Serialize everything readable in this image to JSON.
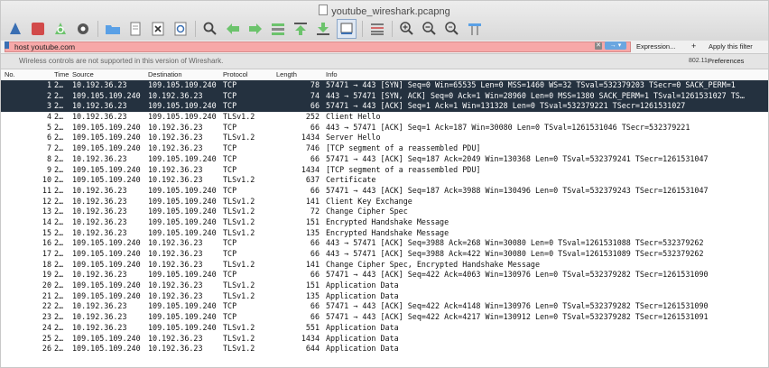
{
  "window": {
    "title": "youtube_wireshark.pcapng"
  },
  "toolbar": {
    "icons": [
      "shark-fin-start-icon",
      "stop-icon",
      "restart-icon",
      "gear-options-icon",
      "folder-open-icon",
      "file-icon",
      "close-file-icon",
      "reload-icon",
      "search-icon",
      "back-arrow-icon",
      "forward-arrow-icon",
      "go-to-packet-icon",
      "first-packet-icon",
      "last-packet-icon",
      "autoscroll-icon",
      "colorize-icon",
      "zoom-in-icon",
      "zoom-out-icon",
      "zoom-reset-icon",
      "resize-columns-icon"
    ]
  },
  "filter": {
    "value": "host youtube.com",
    "expression_label": "Expression...",
    "plus_label": "+",
    "apply_label": "Apply this filter"
  },
  "wireless": {
    "message": "Wireless controls are not supported in this version of Wireshark.",
    "version": "802.11",
    "preferences": "Preferences"
  },
  "columns": {
    "no": "No.",
    "time": "Time",
    "source": "Source",
    "destination": "Destination",
    "protocol": "Protocol",
    "length": "Length",
    "info": "Info"
  },
  "packets": [
    {
      "no": "1",
      "time": "2…",
      "src": "10.192.36.23",
      "dst": "109.105.109.240",
      "proto": "TCP",
      "len": "78",
      "info": "57471 → 443 [SYN] Seq=0 Win=65535 Len=0 MSS=1460 WS=32 TSval=532379203 TSecr=0 SACK_PERM=1",
      "sel": true
    },
    {
      "no": "2",
      "time": "2…",
      "src": "109.105.109.240",
      "dst": "10.192.36.23",
      "proto": "TCP",
      "len": "74",
      "info": "443 → 57471 [SYN, ACK] Seq=0 Ack=1 Win=28960 Len=0 MSS=1380 SACK_PERM=1 TSval=1261531027 TS…",
      "sel": true
    },
    {
      "no": "3",
      "time": "2…",
      "src": "10.192.36.23",
      "dst": "109.105.109.240",
      "proto": "TCP",
      "len": "66",
      "info": "57471 → 443 [ACK] Seq=1 Ack=1 Win=131328 Len=0 TSval=532379221 TSecr=1261531027",
      "sel": true
    },
    {
      "no": "4",
      "time": "2…",
      "src": "10.192.36.23",
      "dst": "109.105.109.240",
      "proto": "TLSv1.2",
      "len": "252",
      "info": "Client Hello"
    },
    {
      "no": "5",
      "time": "2…",
      "src": "109.105.109.240",
      "dst": "10.192.36.23",
      "proto": "TCP",
      "len": "66",
      "info": "443 → 57471 [ACK] Seq=1 Ack=187 Win=30080 Len=0 TSval=1261531046 TSecr=532379221"
    },
    {
      "no": "6",
      "time": "2…",
      "src": "109.105.109.240",
      "dst": "10.192.36.23",
      "proto": "TLSv1.2",
      "len": "1434",
      "info": "Server Hello"
    },
    {
      "no": "7",
      "time": "2…",
      "src": "109.105.109.240",
      "dst": "10.192.36.23",
      "proto": "TCP",
      "len": "746",
      "info": "[TCP segment of a reassembled PDU]"
    },
    {
      "no": "8",
      "time": "2…",
      "src": "10.192.36.23",
      "dst": "109.105.109.240",
      "proto": "TCP",
      "len": "66",
      "info": "57471 → 443 [ACK] Seq=187 Ack=2049 Win=130368 Len=0 TSval=532379241 TSecr=1261531047"
    },
    {
      "no": "9",
      "time": "2…",
      "src": "109.105.109.240",
      "dst": "10.192.36.23",
      "proto": "TCP",
      "len": "1434",
      "info": "[TCP segment of a reassembled PDU]"
    },
    {
      "no": "10",
      "time": "2…",
      "src": "109.105.109.240",
      "dst": "10.192.36.23",
      "proto": "TLSv1.2",
      "len": "637",
      "info": "Certificate"
    },
    {
      "no": "11",
      "time": "2…",
      "src": "10.192.36.23",
      "dst": "109.105.109.240",
      "proto": "TCP",
      "len": "66",
      "info": "57471 → 443 [ACK] Seq=187 Ack=3988 Win=130496 Len=0 TSval=532379243 TSecr=1261531047"
    },
    {
      "no": "12",
      "time": "2…",
      "src": "10.192.36.23",
      "dst": "109.105.109.240",
      "proto": "TLSv1.2",
      "len": "141",
      "info": "Client Key Exchange"
    },
    {
      "no": "13",
      "time": "2…",
      "src": "10.192.36.23",
      "dst": "109.105.109.240",
      "proto": "TLSv1.2",
      "len": "72",
      "info": "Change Cipher Spec"
    },
    {
      "no": "14",
      "time": "2…",
      "src": "10.192.36.23",
      "dst": "109.105.109.240",
      "proto": "TLSv1.2",
      "len": "151",
      "info": "Encrypted Handshake Message"
    },
    {
      "no": "15",
      "time": "2…",
      "src": "10.192.36.23",
      "dst": "109.105.109.240",
      "proto": "TLSv1.2",
      "len": "135",
      "info": "Encrypted Handshake Message"
    },
    {
      "no": "16",
      "time": "2…",
      "src": "109.105.109.240",
      "dst": "10.192.36.23",
      "proto": "TCP",
      "len": "66",
      "info": "443 → 57471 [ACK] Seq=3988 Ack=268 Win=30080 Len=0 TSval=1261531088 TSecr=532379262"
    },
    {
      "no": "17",
      "time": "2…",
      "src": "109.105.109.240",
      "dst": "10.192.36.23",
      "proto": "TCP",
      "len": "66",
      "info": "443 → 57471 [ACK] Seq=3988 Ack=422 Win=30080 Len=0 TSval=1261531089 TSecr=532379262"
    },
    {
      "no": "18",
      "time": "2…",
      "src": "109.105.109.240",
      "dst": "10.192.36.23",
      "proto": "TLSv1.2",
      "len": "141",
      "info": "Change Cipher Spec, Encrypted Handshake Message"
    },
    {
      "no": "19",
      "time": "2…",
      "src": "10.192.36.23",
      "dst": "109.105.109.240",
      "proto": "TCP",
      "len": "66",
      "info": "57471 → 443 [ACK] Seq=422 Ack=4063 Win=130976 Len=0 TSval=532379282 TSecr=1261531090"
    },
    {
      "no": "20",
      "time": "2…",
      "src": "109.105.109.240",
      "dst": "10.192.36.23",
      "proto": "TLSv1.2",
      "len": "151",
      "info": "Application Data"
    },
    {
      "no": "21",
      "time": "2…",
      "src": "109.105.109.240",
      "dst": "10.192.36.23",
      "proto": "TLSv1.2",
      "len": "135",
      "info": "Application Data"
    },
    {
      "no": "22",
      "time": "2…",
      "src": "10.192.36.23",
      "dst": "109.105.109.240",
      "proto": "TCP",
      "len": "66",
      "info": "57471 → 443 [ACK] Seq=422 Ack=4148 Win=130976 Len=0 TSval=532379282 TSecr=1261531090"
    },
    {
      "no": "23",
      "time": "2…",
      "src": "10.192.36.23",
      "dst": "109.105.109.240",
      "proto": "TCP",
      "len": "66",
      "info": "57471 → 443 [ACK] Seq=422 Ack=4217 Win=130912 Len=0 TSval=532379282 TSecr=1261531091"
    },
    {
      "no": "24",
      "time": "2…",
      "src": "10.192.36.23",
      "dst": "109.105.109.240",
      "proto": "TLSv1.2",
      "len": "551",
      "info": "Application Data"
    },
    {
      "no": "25",
      "time": "2…",
      "src": "109.105.109.240",
      "dst": "10.192.36.23",
      "proto": "TLSv1.2",
      "len": "1434",
      "info": "Application Data"
    },
    {
      "no": "26",
      "time": "2…",
      "src": "109.105.109.240",
      "dst": "10.192.36.23",
      "proto": "TLSv1.2",
      "len": "644",
      "info": "Application Data"
    }
  ],
  "colors": {
    "selected_row": "#24313f",
    "filter_bg": "#f7a8a8",
    "accent_blue": "#3a6fb3"
  }
}
